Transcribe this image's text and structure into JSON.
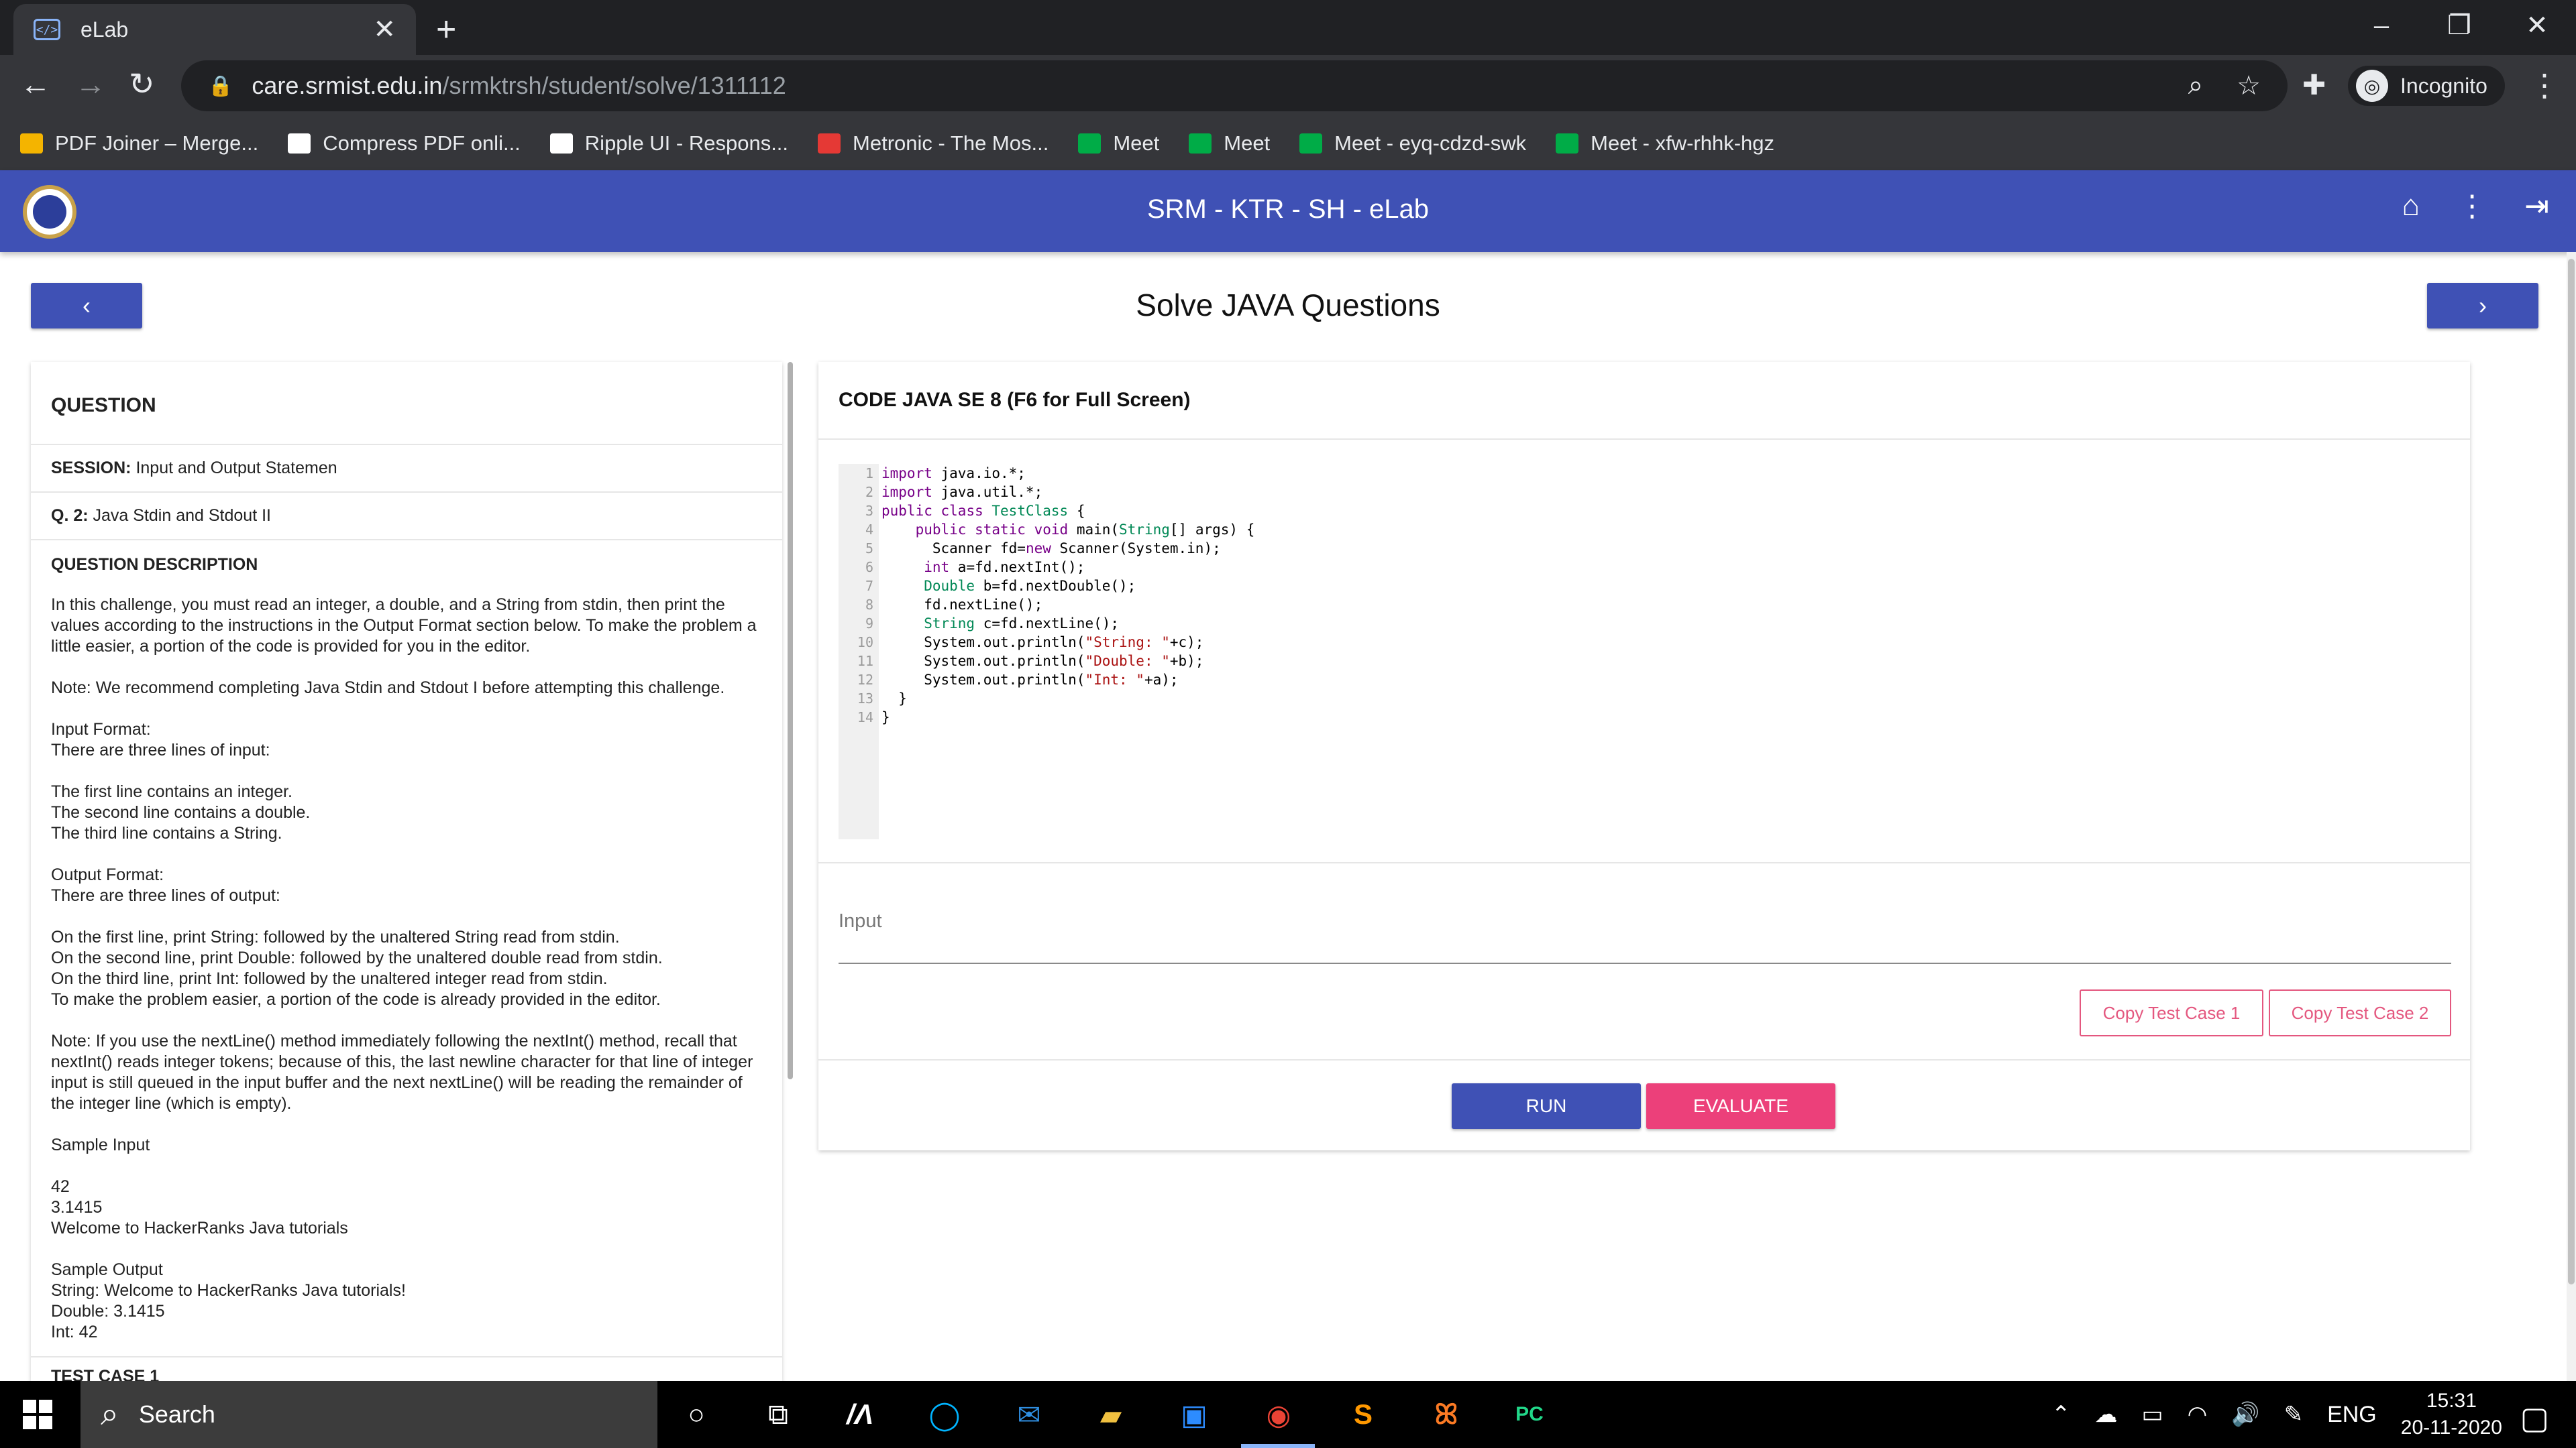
{
  "browser": {
    "tab_title": "eLab",
    "url_host": "care.srmist.edu.in",
    "url_path": "/srmktrsh/student/solve/1311112",
    "profile_label": "Incognito",
    "bookmarks": [
      {
        "label": "PDF Joiner – Merge...",
        "color": "#f4b400"
      },
      {
        "label": "Compress PDF onli...",
        "color": "#ffffff"
      },
      {
        "label": "Ripple UI - Respons...",
        "color": "#ffffff"
      },
      {
        "label": "Metronic - The Mos...",
        "color": "#e53935"
      },
      {
        "label": "Meet",
        "color": "#00ac47"
      },
      {
        "label": "Meet",
        "color": "#00ac47"
      },
      {
        "label": "Meet - eyq-cdzd-swk",
        "color": "#00ac47"
      },
      {
        "label": "Meet - xfw-rhhk-hgz",
        "color": "#00ac47"
      }
    ]
  },
  "app": {
    "title": "SRM - KTR - SH - eLab",
    "page_heading": "Solve JAVA Questions",
    "prev_label": "‹",
    "next_label": "›"
  },
  "question": {
    "header": "QUESTION",
    "session_label": "SESSION:",
    "session_value": "Input and Output Statemen",
    "q_label": "Q. 2:",
    "q_value": "Java Stdin and Stdout II",
    "desc_header": "QUESTION DESCRIPTION",
    "description": "In this challenge, you must read an integer, a double, and a String from stdin, then print the values according to the instructions in the Output Format section below. To make the problem a little easier, a portion of the code is provided for you in the editor.\n\nNote: We recommend completing Java Stdin and Stdout I before attempting this challenge.\n\nInput Format:\nThere are three lines of input:\n\nThe first line contains an integer.\nThe second line contains a double.\nThe third line contains a String.\n\nOutput Format:\nThere are three lines of output:\n\nOn the first line, print String: followed by the unaltered String read from stdin.\nOn the second line, print Double: followed by the unaltered double read from stdin.\nOn the third line, print Int: followed by the unaltered integer read from stdin.\nTo make the problem easier, a portion of the code is already provided in the editor.\n\nNote: If you use the nextLine() method immediately following the nextInt() method, recall that nextInt() reads integer tokens; because of this, the last newline character for that line of integer input is still queued in the input buffer and the next nextLine() will be reading the remainder of the integer line (which is empty).\n\nSample Input\n\n42\n3.1415\nWelcome to HackerRanks Java tutorials\n\nSample Output\nString: Welcome to HackerRanks Java tutorials!\nDouble: 3.1415\nInt: 42",
    "test_case_header": "TEST CASE 1"
  },
  "code": {
    "header": "CODE JAVA SE 8 (F6 for Full Screen)",
    "line_numbers": [
      "1",
      "2",
      "3",
      "4",
      "5",
      "6",
      "7",
      "8",
      "9",
      "10",
      "11",
      "12",
      "13",
      "14"
    ],
    "lines": [
      "import java.io.*;",
      "import java.util.*;",
      "public class TestClass {",
      "    public static void main(String[] args) {",
      "      Scanner fd=new Scanner(System.in);",
      "     int a=fd.nextInt();",
      "     Double b=fd.nextDouble();",
      "     fd.nextLine();",
      "     String c=fd.nextLine();",
      "     System.out.println(\"String: \"+c);",
      "     System.out.println(\"Double: \"+b);",
      "     System.out.println(\"Int: \"+a);",
      "  }",
      "}"
    ],
    "input_label": "Input",
    "copy1_label": "Copy Test Case 1",
    "copy2_label": "Copy Test Case 2",
    "run_label": "RUN",
    "evaluate_label": "EVALUATE"
  },
  "colors": {
    "primary": "#3f51b5",
    "accent": "#ec407a"
  },
  "taskbar": {
    "search_placeholder": "Search",
    "lang": "ENG",
    "time": "15:31",
    "date": "20-11-2020"
  }
}
